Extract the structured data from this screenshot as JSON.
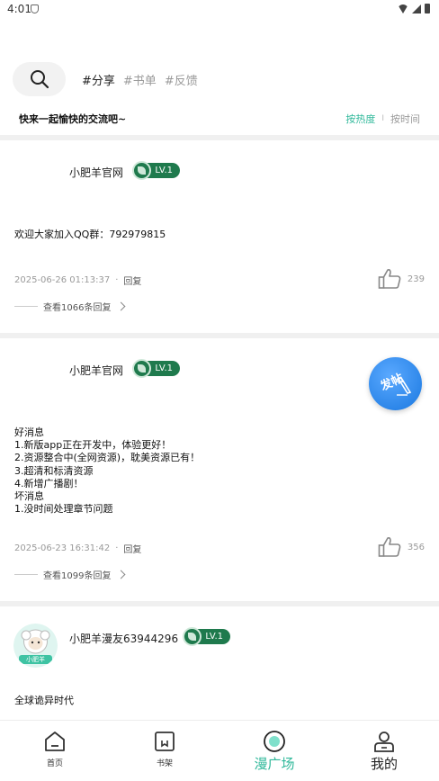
{
  "status": {
    "time": "4:01"
  },
  "search": {
    "icon": "search-icon"
  },
  "tags": [
    "#分享",
    "#书单",
    "#反馈"
  ],
  "subhead": {
    "slogan": "快来一起愉快的交流吧~",
    "sort_hot": "按热度",
    "sort_sep": "I",
    "sort_time": "按时间"
  },
  "colors": {
    "accent": "#2fb89a",
    "badge": "#1f7a4d",
    "fab": "#1a78e0"
  },
  "posts": [
    {
      "author": "小肥羊官网",
      "level": "LV.1",
      "body": "欢迎大家加入QQ群：792979815",
      "time": "2025-06-26 01:13:37",
      "dot": "·",
      "reply": "回复",
      "likes": "239",
      "view_replies": "查看1066条回复"
    },
    {
      "author": "小肥羊官网",
      "level": "LV.1",
      "body": "好消息\n1.新版app正在开发中，体验更好！\n2.资源整合中(全网资源)，耽美资源已有！\n3.超清和标清资源\n4.新增广播剧！\n坏消息\n1.没时间处理章节问题",
      "time": "2025-06-23 16:31:42",
      "dot": "·",
      "reply": "回复",
      "likes": "356",
      "view_replies": "查看1099条回复"
    },
    {
      "author": "小肥羊漫友63944296",
      "level": "LV.1",
      "avatar_text": "小肥羊",
      "body": "全球诡异时代"
    }
  ],
  "fab": {
    "label": "发帖"
  },
  "nav": [
    {
      "label": "首页",
      "icon": "home-icon"
    },
    {
      "label": "书架",
      "icon": "bookshelf-icon"
    },
    {
      "label": "漫广场",
      "icon": "plaza-icon"
    },
    {
      "label": "我的",
      "icon": "profile-icon"
    }
  ]
}
